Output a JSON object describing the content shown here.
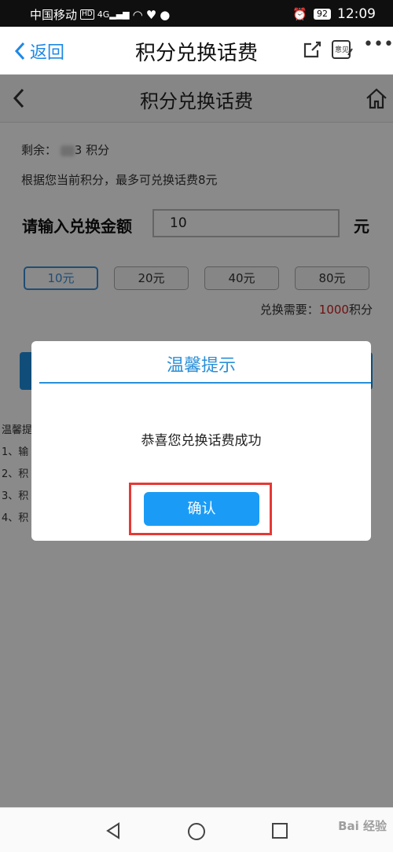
{
  "status_bar": {
    "carrier": "中国移动",
    "hd": "HD",
    "signal": "4G",
    "battery": "92",
    "time": "12:09"
  },
  "app_bar": {
    "back_label": "返回",
    "title": "积分兑换话费",
    "share_icon": "share-icon",
    "feedback_label": "意见",
    "more_icon": "more-icon"
  },
  "web_header": {
    "title": "积分兑换话费",
    "back_icon": "chevron-left-icon",
    "home_icon": "home-icon"
  },
  "balance": {
    "label": "剩余：",
    "value_suffix": "3",
    "unit": "积分"
  },
  "max_exchange_text": "根据您当前积分，最多可兑换话费8元",
  "amount_input": {
    "label": "请输入兑换金额",
    "value": "10",
    "unit": "元"
  },
  "options": [
    {
      "label": "10元",
      "selected": true
    },
    {
      "label": "20元",
      "selected": false
    },
    {
      "label": "40元",
      "selected": false
    },
    {
      "label": "80元",
      "selected": false
    }
  ],
  "requirement": {
    "label": "兑换需要：",
    "points": "1000",
    "unit": "积分"
  },
  "tips": [
    "温馨提",
    "1、输",
    "2、积",
    "3、积",
    "4、积"
  ],
  "dialog": {
    "title": "温馨提示",
    "message": "恭喜您兑换话费成功",
    "confirm_label": "确认"
  },
  "watermark": "Bai 经验"
}
